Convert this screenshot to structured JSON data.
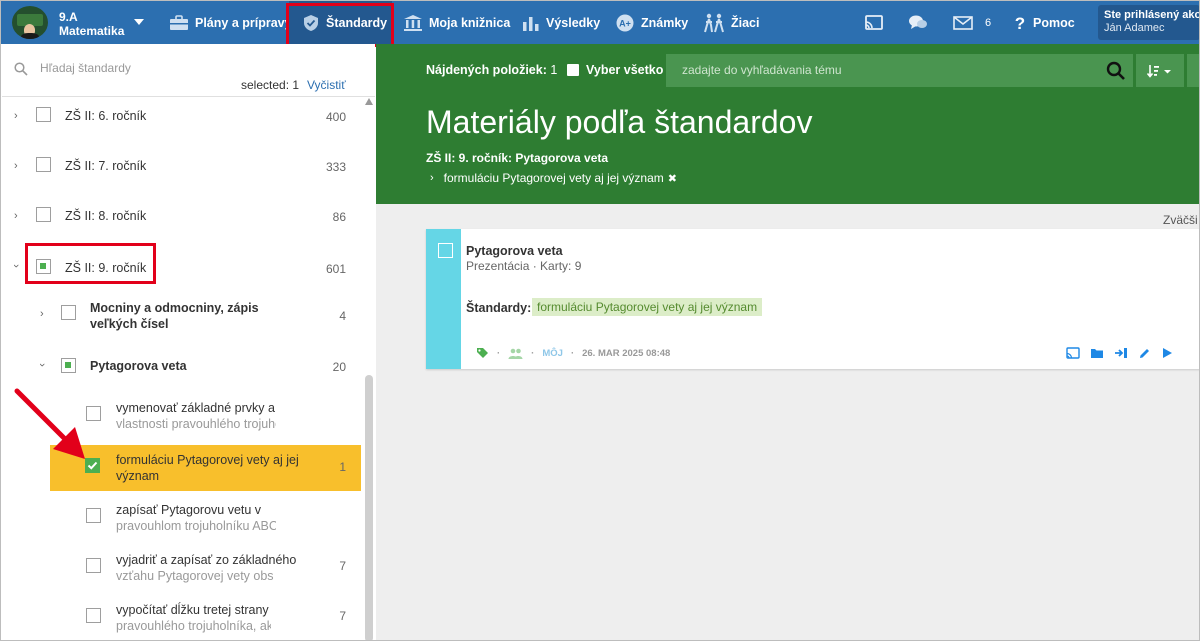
{
  "topbar": {
    "class_name_line1": "9.A",
    "class_name_line2": "Matematika",
    "nav": [
      {
        "label": "Plány a prípravy",
        "icon": "briefcase-icon"
      },
      {
        "label": "Štandardy",
        "icon": "shield-icon",
        "active": true
      },
      {
        "label": "Moja knižnica",
        "icon": "library-icon"
      },
      {
        "label": "Výsledky",
        "icon": "bar-chart-icon"
      },
      {
        "label": "Známky",
        "icon": "grades-icon"
      },
      {
        "label": "Žiaci",
        "icon": "students-icon"
      }
    ],
    "messages_count": "6",
    "help_label": "Pomoc",
    "user_line1": "Ste prihlásený ako",
    "user_line2": "Ján Adamec"
  },
  "sidebar": {
    "search_placeholder": "Hľadaj štandardy",
    "selected_text": "selected: 1",
    "clear_label": "Vyčistiť",
    "tree": [
      {
        "label": "ZŠ II: 6. ročník",
        "count": "400"
      },
      {
        "label": "ZŠ II: 7. ročník",
        "count": "333"
      },
      {
        "label": "ZŠ II: 8. ročník",
        "count": "86"
      },
      {
        "label": "ZŠ II: 9. ročník",
        "count": "601"
      },
      {
        "label_line1": "Mocniny a odmocniny, zápis",
        "label_line2": "veľkých čísel",
        "count": "4"
      },
      {
        "label": "Pytagorova veta",
        "count": "20"
      },
      {
        "label_line1": "vymenovať základné prvky a",
        "label_line2": "vlastnosti pravouhlého trojuho",
        "count": ""
      },
      {
        "label_line1": "formuláciu Pytagorovej vety aj jej",
        "label_line2": "význam",
        "count": "1"
      },
      {
        "label_line1": "zapísať Pytagorovu vetu v",
        "label_line2": "pravouhlom trojuholníku ABC",
        "count": ""
      },
      {
        "label_line1": "vyjadriť a zapísať zo základného",
        "label_line2": "vzťahu Pytagorovej vety obs",
        "count": "7"
      },
      {
        "label_line1": "vypočítať dĺžku tretej strany",
        "label_line2": "pravouhlého trojuholníka, ak",
        "count": "7"
      }
    ]
  },
  "main": {
    "found_label": "Nájdených položiek:",
    "found_count": "1",
    "select_all_label": "Vyber všetko",
    "search_placeholder": "zadajte do vyhľadávania tému",
    "title": "Materiály podľa štandardov",
    "breadcrumb": "ZŠ II: 9. ročník: Pytagorova veta",
    "filter": "formuláciu Pytagorovej vety aj jej význam",
    "zoom_label": "Zväčši",
    "card": {
      "title": "Pytagorova veta",
      "subtitle": "Prezentácia · Karty: 9",
      "standards_label": "Štandardy:",
      "standard_chip": "formuláciu Pytagorovej vety aj jej význam",
      "owner": "MÔJ",
      "date": "26. MAR 2025 08:48"
    }
  },
  "colors": {
    "topbar": "#2c6fb0",
    "main_green": "#2e7d32",
    "highlight": "#f8bf2c",
    "checked_green": "#4caf50",
    "card_stripe": "#65d6e6",
    "annotation_red": "#e2001a"
  }
}
